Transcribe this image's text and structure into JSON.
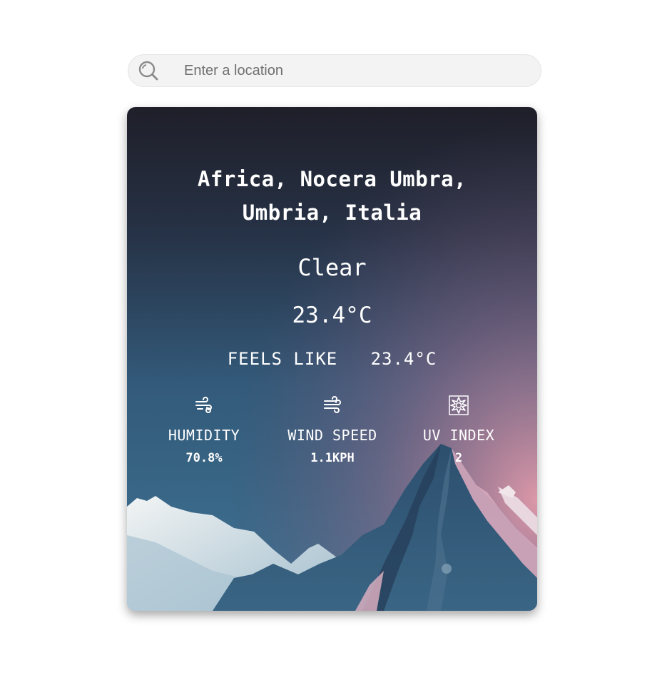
{
  "search": {
    "placeholder": "Enter a location",
    "value": ""
  },
  "weather": {
    "location": "Africa, Nocera Umbra, Umbria, Italia",
    "condition": "Clear",
    "temperature": "23.4°C",
    "feels_like_label": "FEELS LIKE",
    "feels_like_value": "23.4°C"
  },
  "stats": [
    {
      "label": "HUMIDITY",
      "value": "70.8%",
      "icon": "humidity-wind-icon"
    },
    {
      "label": "WIND SPEED",
      "value": "1.1KPH",
      "icon": "wind-icon"
    },
    {
      "label": "UV INDEX",
      "value": "2",
      "icon": "sun-icon"
    }
  ],
  "colors": {
    "sky_top": "#22222d",
    "sky_mid": "#2f4a66",
    "sky_low": "#3b6585",
    "pink_glow": "#c48a9c",
    "snow": "#dfe9ee",
    "mountain": "#2c4c6a"
  }
}
